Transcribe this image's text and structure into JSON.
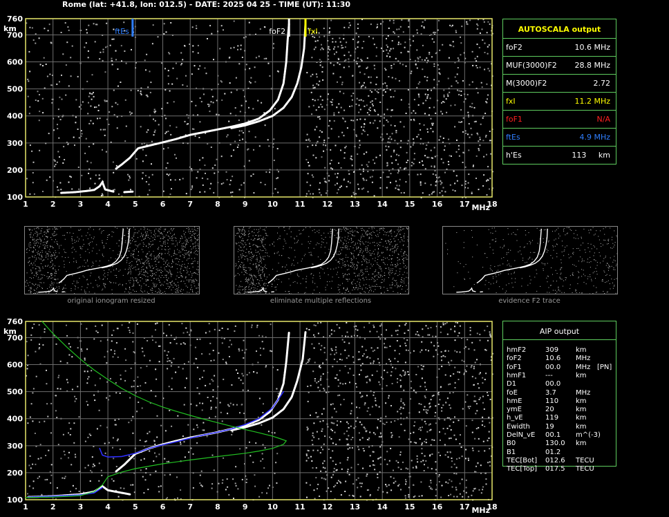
{
  "header": "Rome (lat: +41.8, lon: 012.5) - DATE: 2025 04 25 - TIME (UT): 11:30",
  "chart_data": [
    {
      "type": "scatter",
      "name": "ionogram-top",
      "xlabel": "MHz",
      "ylabel": "km",
      "xlim": [
        1,
        18
      ],
      "ylim": [
        100,
        760
      ],
      "xticks": [
        "1",
        "2",
        "3",
        "4",
        "5",
        "6",
        "7",
        "8",
        "9",
        "10",
        "11",
        "12",
        "13",
        "14",
        "15",
        "16",
        "17",
        "18"
      ],
      "yticks": [
        "100",
        "200",
        "300",
        "400",
        "500",
        "600",
        "700",
        "760"
      ],
      "grid": true,
      "markers": [
        {
          "label": "ftEs",
          "x": 4.9,
          "color": "#2f7fff"
        },
        {
          "label": "foF2",
          "x": 10.6,
          "color": "#ffffff"
        },
        {
          "label": "fxI",
          "x": 11.2,
          "color": "#ffff00"
        }
      ],
      "series": [
        {
          "color": "#ffffff",
          "points": [
            [
              2.3,
              115
            ],
            [
              2.8,
              118
            ],
            [
              3.2,
              122
            ],
            [
              3.5,
              126
            ],
            [
              3.7,
              140
            ],
            [
              3.8,
              155
            ],
            [
              3.9,
              128
            ],
            [
              4.2,
              120
            ]
          ]
        },
        {
          "color": "#ffffff",
          "points": [
            [
              4.6,
              118
            ],
            [
              4.9,
              120
            ]
          ]
        },
        {
          "color": "#ffffff",
          "points": [
            [
              4.3,
              205
            ],
            [
              4.5,
              220
            ],
            [
              4.8,
              245
            ],
            [
              5.1,
              280
            ],
            [
              5.5,
              290
            ],
            [
              6,
              302
            ],
            [
              6.5,
              315
            ],
            [
              7,
              330
            ],
            [
              7.5,
              340
            ],
            [
              8,
              350
            ],
            [
              8.5,
              360
            ],
            [
              9,
              372
            ],
            [
              9.5,
              390
            ],
            [
              9.9,
              420
            ],
            [
              10.2,
              460
            ],
            [
              10.4,
              520
            ],
            [
              10.5,
              600
            ],
            [
              10.55,
              680
            ],
            [
              10.6,
              740
            ]
          ]
        },
        {
          "color": "#ffffff",
          "points": [
            [
              8.5,
              355
            ],
            [
              9,
              365
            ],
            [
              9.5,
              380
            ],
            [
              10,
              400
            ],
            [
              10.4,
              430
            ],
            [
              10.7,
              470
            ],
            [
              10.9,
              520
            ],
            [
              11.05,
              580
            ],
            [
              11.15,
              650
            ],
            [
              11.2,
              740
            ]
          ]
        }
      ]
    },
    {
      "type": "scatter",
      "name": "ionogram-bottom",
      "xlabel": "MHz",
      "ylabel": "km",
      "xlim": [
        1,
        18
      ],
      "ylim": [
        100,
        760
      ],
      "xticks": [
        "1",
        "2",
        "3",
        "4",
        "5",
        "6",
        "7",
        "8",
        "9",
        "10",
        "11",
        "12",
        "13",
        "14",
        "15",
        "16",
        "17",
        "18"
      ],
      "yticks": [
        "100",
        "200",
        "300",
        "400",
        "500",
        "600",
        "700",
        "760"
      ],
      "grid": true,
      "series": [
        {
          "color": "#ffffff",
          "points": [
            [
              4.3,
              205
            ],
            [
              4.6,
              230
            ],
            [
              5,
              270
            ],
            [
              5.5,
              290
            ],
            [
              6,
              305
            ],
            [
              6.5,
              318
            ],
            [
              7,
              330
            ],
            [
              7.5,
              340
            ],
            [
              8,
              350
            ],
            [
              8.5,
              362
            ],
            [
              9,
              375
            ],
            [
              9.5,
              395
            ],
            [
              9.9,
              425
            ],
            [
              10.2,
              470
            ],
            [
              10.4,
              530
            ],
            [
              10.5,
              610
            ],
            [
              10.6,
              720
            ]
          ]
        },
        {
          "color": "#ffffff",
          "points": [
            [
              8.5,
              357
            ],
            [
              9,
              368
            ],
            [
              9.5,
              383
            ],
            [
              10,
              404
            ],
            [
              10.4,
              435
            ],
            [
              10.7,
              480
            ],
            [
              10.9,
              540
            ],
            [
              11.1,
              620
            ],
            [
              11.2,
              720
            ]
          ]
        },
        {
          "color": "#ffffff",
          "points": [
            [
              1.1,
              110
            ],
            [
              2,
              113
            ],
            [
              3,
              120
            ],
            [
              3.5,
              130
            ],
            [
              3.8,
              150
            ],
            [
              4,
              135
            ],
            [
              4.8,
              120
            ]
          ]
        },
        {
          "color": "#2f2fff",
          "points": [
            [
              3.7,
              290
            ],
            [
              3.8,
              265
            ],
            [
              4,
              258
            ],
            [
              4.5,
              260
            ],
            [
              5,
              272
            ],
            [
              5.5,
              290
            ],
            [
              6,
              303
            ],
            [
              6.5,
              315
            ],
            [
              7,
              328
            ],
            [
              7.5,
              340
            ],
            [
              8,
              350
            ],
            [
              8.5,
              362
            ],
            [
              9,
              378
            ],
            [
              9.5,
              400
            ],
            [
              10,
              440
            ],
            [
              10.4,
              500
            ]
          ]
        },
        {
          "color": "#2f2fff",
          "points": [
            [
              1.1,
              110
            ],
            [
              2,
              113
            ],
            [
              3,
              118
            ],
            [
              3.5,
              125
            ],
            [
              3.8,
              145
            ]
          ]
        },
        {
          "color": "#22c222",
          "points": [
            [
              1.6,
              760
            ],
            [
              2,
              715
            ],
            [
              2.5,
              665
            ],
            [
              3,
              620
            ],
            [
              3.5,
              580
            ],
            [
              4,
              545
            ],
            [
              4.5,
              512
            ],
            [
              5,
              485
            ],
            [
              5.5,
              462
            ],
            [
              6,
              443
            ],
            [
              6.5,
              427
            ],
            [
              7,
              412
            ],
            [
              7.5,
              398
            ],
            [
              8,
              385
            ],
            [
              8.5,
              372
            ],
            [
              9,
              360
            ],
            [
              9.5,
              348
            ],
            [
              10,
              335
            ],
            [
              10.3,
              325
            ],
            [
              10.5,
              318
            ],
            [
              10.4,
              305
            ],
            [
              10,
              290
            ],
            [
              9.5,
              280
            ],
            [
              9,
              272
            ],
            [
              8,
              260
            ],
            [
              7,
              247
            ],
            [
              6,
              233
            ],
            [
              5,
              215
            ],
            [
              4.5,
              202
            ],
            [
              4,
              185
            ],
            [
              3.8,
              155
            ],
            [
              3.5,
              130
            ],
            [
              3,
              115
            ],
            [
              2,
              110
            ],
            [
              1,
              108
            ]
          ]
        }
      ]
    },
    {
      "type": "scatter",
      "name": "thumb-original",
      "caption": "original ionogram resized"
    },
    {
      "type": "scatter",
      "name": "thumb-eliminate",
      "caption": "eliminate multiple reflections"
    },
    {
      "type": "scatter",
      "name": "thumb-evidence",
      "caption": "evidence F2 trace"
    }
  ],
  "autoscala": {
    "title": "AUTOSCALA output",
    "rows": [
      {
        "label": "foF2",
        "value": "10.6 MHz",
        "color": "#ffffff"
      },
      {
        "label": "MUF(3000)F2",
        "value": "28.8 MHz",
        "color": "#ffffff"
      },
      {
        "label": "M(3000)F2",
        "value": "2.72",
        "color": "#ffffff"
      },
      {
        "label": "fxI",
        "value": "11.2 MHz",
        "color": "#ffff00"
      },
      {
        "label": "foF1",
        "value": "N/A",
        "color": "#ff2020"
      },
      {
        "label": "ftEs",
        "value": "4.9 MHz",
        "color": "#2f7fff"
      },
      {
        "label": "h'Es",
        "value": "113     km",
        "color": "#ffffff"
      }
    ]
  },
  "aip": {
    "title": "AIP output",
    "rows": [
      {
        "label": "hmF2",
        "value": "309",
        "unit": "km",
        "extra": ""
      },
      {
        "label": "foF2",
        "value": "10.6",
        "unit": "MHz",
        "extra": ""
      },
      {
        "label": "foF1",
        "value": "00.0",
        "unit": "MHz",
        "extra": "[PN]"
      },
      {
        "label": "hmF1",
        "value": "---",
        "unit": "km",
        "extra": ""
      },
      {
        "label": "D1",
        "value": "00.0",
        "unit": "",
        "extra": ""
      },
      {
        "label": "foE",
        "value": "3.7",
        "unit": "MHz",
        "extra": ""
      },
      {
        "label": "hmE",
        "value": "110",
        "unit": "km",
        "extra": ""
      },
      {
        "label": "ymE",
        "value": "20",
        "unit": "km",
        "extra": ""
      },
      {
        "label": "h_vE",
        "value": "119",
        "unit": "km",
        "extra": ""
      },
      {
        "label": "Ewidth",
        "value": "19",
        "unit": "km",
        "extra": ""
      },
      {
        "label": "DelN_vE",
        "value": "00.1",
        "unit": "m^(-3)",
        "extra": ""
      },
      {
        "label": "B0",
        "value": "130.0",
        "unit": "km",
        "extra": ""
      },
      {
        "label": "B1",
        "value": "01.2",
        "unit": "",
        "extra": ""
      },
      {
        "label": "TEC[Bot]",
        "value": "012.6",
        "unit": "TECU",
        "extra": ""
      },
      {
        "label": "TEC[Top]",
        "value": "017.5",
        "unit": "TECU",
        "extra": ""
      }
    ]
  }
}
